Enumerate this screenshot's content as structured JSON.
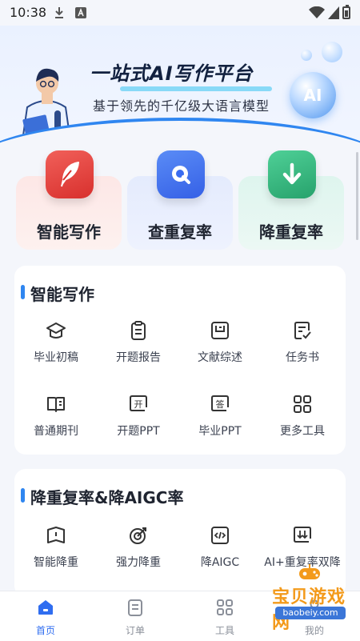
{
  "status": {
    "time": "10:38"
  },
  "banner": {
    "title": "一站式AI写作平台",
    "subtitle": "基于领先的千亿级大语言模型",
    "ai_badge": "AI"
  },
  "features": [
    {
      "label": "智能写作",
      "icon": "quill-icon",
      "color": "#e9443f"
    },
    {
      "label": "查重复率",
      "icon": "search-q-icon",
      "color": "#3a6cf0"
    },
    {
      "label": "降重复率",
      "icon": "down-arrow-icon",
      "color": "#33b27a"
    }
  ],
  "writing": {
    "title": "智能写作",
    "tools": [
      {
        "label": "毕业初稿",
        "icon": "graduation-cap-icon"
      },
      {
        "label": "开题报告",
        "icon": "clipboard-icon"
      },
      {
        "label": "文献综述",
        "icon": "document-frame-icon"
      },
      {
        "label": "任务书",
        "icon": "checklist-icon"
      },
      {
        "label": "普通期刊",
        "icon": "open-book-icon"
      },
      {
        "label": "开题PPT",
        "icon": "ppt-open-icon",
        "glyph": "开"
      },
      {
        "label": "毕业PPT",
        "icon": "ppt-grad-icon",
        "glyph": "答"
      },
      {
        "label": "更多工具",
        "icon": "grid-icon"
      }
    ]
  },
  "reduce": {
    "title": "降重复率&降AIGC率",
    "tools": [
      {
        "label": "智能降重",
        "icon": "book-icon"
      },
      {
        "label": "强力降重",
        "icon": "target-icon"
      },
      {
        "label": "降AIGC",
        "icon": "code-icon"
      },
      {
        "label": "AI+重复率双降",
        "icon": "double-down-icon"
      }
    ]
  },
  "tabs": [
    {
      "label": "首页",
      "icon": "home-icon",
      "active": true
    },
    {
      "label": "订单",
      "icon": "order-icon",
      "active": false
    },
    {
      "label": "工具",
      "icon": "tools-icon",
      "active": false
    },
    {
      "label": "我的",
      "icon": "user-icon",
      "active": false
    }
  ],
  "watermark": {
    "text": "宝贝游戏网",
    "url": "baobeiy.com"
  }
}
